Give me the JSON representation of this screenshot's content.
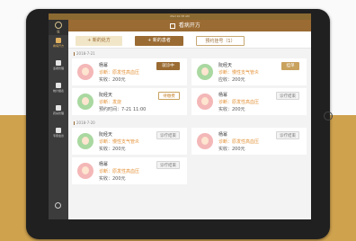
{
  "status_bar": {
    "text": "iPad  10:38 AM"
  },
  "app": {
    "title": "看病开方"
  },
  "sidebar": {
    "logo_text": "医",
    "items": [
      {
        "label": "看病开方",
        "active": true
      },
      {
        "label": "患者管理",
        "active": false
      },
      {
        "label": "统计报表",
        "active": false
      },
      {
        "label": "药房管理",
        "active": false
      },
      {
        "label": "专家会诊",
        "active": false
      }
    ]
  },
  "toolbar": {
    "new_prescription": "+ 新的处方",
    "new_patient": "+ 新的患者",
    "appointment": "预约挂号（1）"
  },
  "groups": [
    {
      "date": "2018-7-21",
      "cards": [
        {
          "name": "杨幂",
          "diagnosis": "诊断：原发性高血压",
          "extra": "实收：200元",
          "status": "就诊中",
          "status_type": "treat",
          "avatar": "pink"
        },
        {
          "name": "阮经天",
          "diagnosis": "诊断：慢性支气管炎",
          "extra": "应收：200元",
          "status": "挂单",
          "status_type": "wait",
          "avatar": "green"
        },
        {
          "name": "阮经天",
          "diagnosis": "诊断：发烧",
          "extra": "预约时间：7-21 11:00",
          "status": "待缴费",
          "status_type": "pay",
          "avatar": "green"
        },
        {
          "name": "杨幂",
          "diagnosis": "诊断：原发性高血压",
          "extra": "实收：200元",
          "status": "诊疗结束",
          "status_type": "done",
          "avatar": "pink"
        }
      ]
    },
    {
      "date": "2018-7-20",
      "cards": [
        {
          "name": "阮经天",
          "diagnosis": "诊断：慢性支气管炎",
          "extra": "实收：200元",
          "status": "诊疗结束",
          "status_type": "done",
          "avatar": "green"
        },
        {
          "name": "杨幂",
          "diagnosis": "诊断：原发性高血压",
          "extra": "实收：200元",
          "status": "诊疗结束",
          "status_type": "done",
          "avatar": "pink"
        },
        {
          "name": "杨幂",
          "diagnosis": "诊断：原发性高血压",
          "extra": "实收：200元",
          "status": "诊疗结束",
          "status_type": "done",
          "avatar": "pink"
        }
      ]
    }
  ],
  "colors": {
    "brand": "#9a6b33",
    "gold_background": "#cfa24e",
    "accent_text": "#e39035",
    "sidebar": "#3c3c3c"
  },
  "icons": [
    "gear-icon",
    "prescription-icon"
  ]
}
